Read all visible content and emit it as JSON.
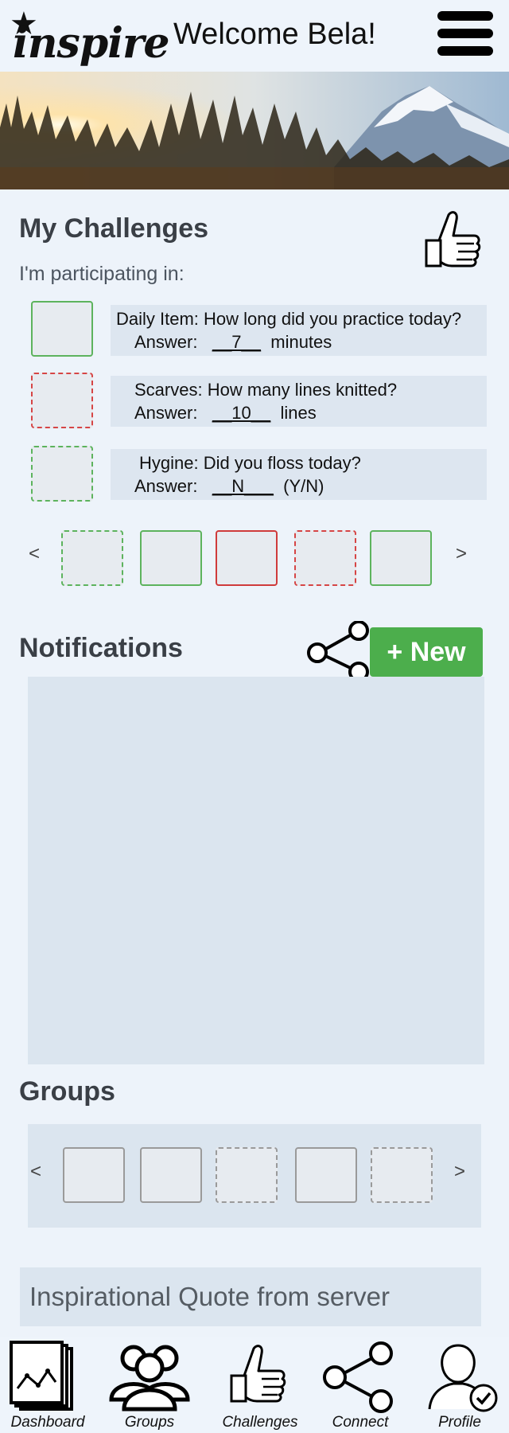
{
  "header": {
    "logo_text": "inspire",
    "welcome": "Welcome Bela!"
  },
  "challenges": {
    "title": "My Challenges",
    "subtitle": "I'm participating in:",
    "items": [
      {
        "question": "Daily Item: How long did you practice today?",
        "answer_label": "Answer:",
        "answer_value": "__7__",
        "unit": "minutes"
      },
      {
        "question": "Scarves: How many lines knitted?",
        "answer_label": "Answer:",
        "answer_value": "__10__",
        "unit": "lines"
      },
      {
        "question": "Hygine: Did you floss today?",
        "answer_label": "Answer:",
        "answer_value": "__N___",
        "unit": "(Y/N)"
      }
    ],
    "carousel_prev": "<",
    "carousel_next": ">"
  },
  "notifications": {
    "title": "Notifications",
    "new_button": "+ New"
  },
  "groups": {
    "title": "Groups",
    "carousel_prev": "<",
    "carousel_next": ">"
  },
  "quote": {
    "placeholder": "Inspirational Quote from server"
  },
  "nav": {
    "items": [
      {
        "label": "Dashboard",
        "icon": "dashboard-icon"
      },
      {
        "label": "Groups",
        "icon": "groups-icon"
      },
      {
        "label": "Challenges",
        "icon": "thumbs-up-icon"
      },
      {
        "label": "Connect",
        "icon": "share-icon"
      },
      {
        "label": "Profile",
        "icon": "profile-icon"
      }
    ]
  },
  "colors": {
    "accent_green": "#4cae4c",
    "status_red": "#d64545",
    "panel": "#dbe5ef",
    "background": "#edf3fa"
  }
}
